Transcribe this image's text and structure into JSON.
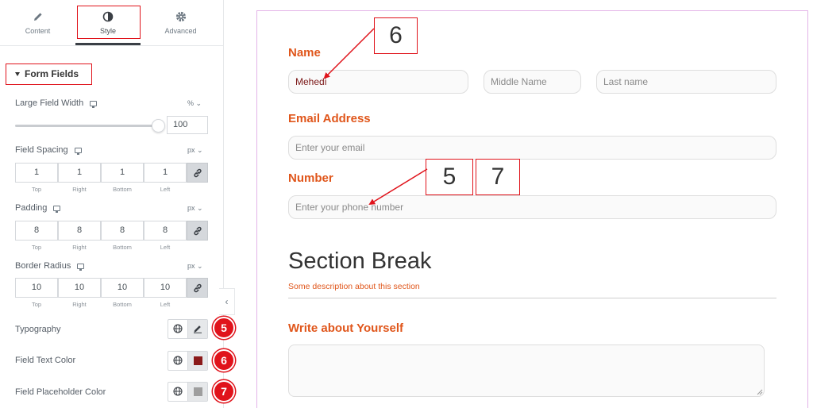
{
  "panel": {
    "tabs": [
      {
        "label": "Content",
        "icon": "pencil-icon"
      },
      {
        "label": "Style",
        "icon": "contrast-icon"
      },
      {
        "label": "Advanced",
        "icon": "gear-icon"
      }
    ],
    "active_tab": "Style",
    "section_title": "Form Fields",
    "large_field_width": {
      "label": "Large Field Width",
      "unit": "% ⌄",
      "value": "100",
      "slider_level": 1.0
    },
    "field_spacing": {
      "label": "Field Spacing",
      "unit": "px ⌄",
      "values": [
        "1",
        "1",
        "1",
        "1"
      ]
    },
    "padding": {
      "label": "Padding",
      "unit": "px ⌄",
      "values": [
        "8",
        "8",
        "8",
        "8"
      ]
    },
    "border_radius": {
      "label": "Border Radius",
      "unit": "px ⌄",
      "values": [
        "10",
        "10",
        "10",
        "10"
      ]
    },
    "dim_captions": [
      "Top",
      "Right",
      "Bottom",
      "Left"
    ],
    "typography": {
      "label": "Typography",
      "badge": "5"
    },
    "field_text_color": {
      "label": "Field Text Color",
      "badge": "6",
      "color": "#8b1a1a"
    },
    "field_placeholder_color": {
      "label": "Field Placeholder Color",
      "badge": "7",
      "color": "#9e9e9e"
    },
    "collapse_glyph": "‹"
  },
  "preview": {
    "name_label": "Name",
    "first_name_value": "Mehedi",
    "middle_name_placeholder": "Middle Name",
    "last_name_placeholder": "Last name",
    "email_label": "Email Address",
    "email_placeholder": "Enter your email",
    "number_label": "Number",
    "phone_placeholder": "Enter your phone number",
    "section_title": "Section Break",
    "section_desc": "Some description about this section",
    "about_label": "Write about Yourself"
  },
  "callouts": [
    "6",
    "5",
    "7"
  ],
  "colors": {
    "accent": "#e0131b",
    "label": "#e0561b",
    "preview_border": "#e3b4e8"
  }
}
